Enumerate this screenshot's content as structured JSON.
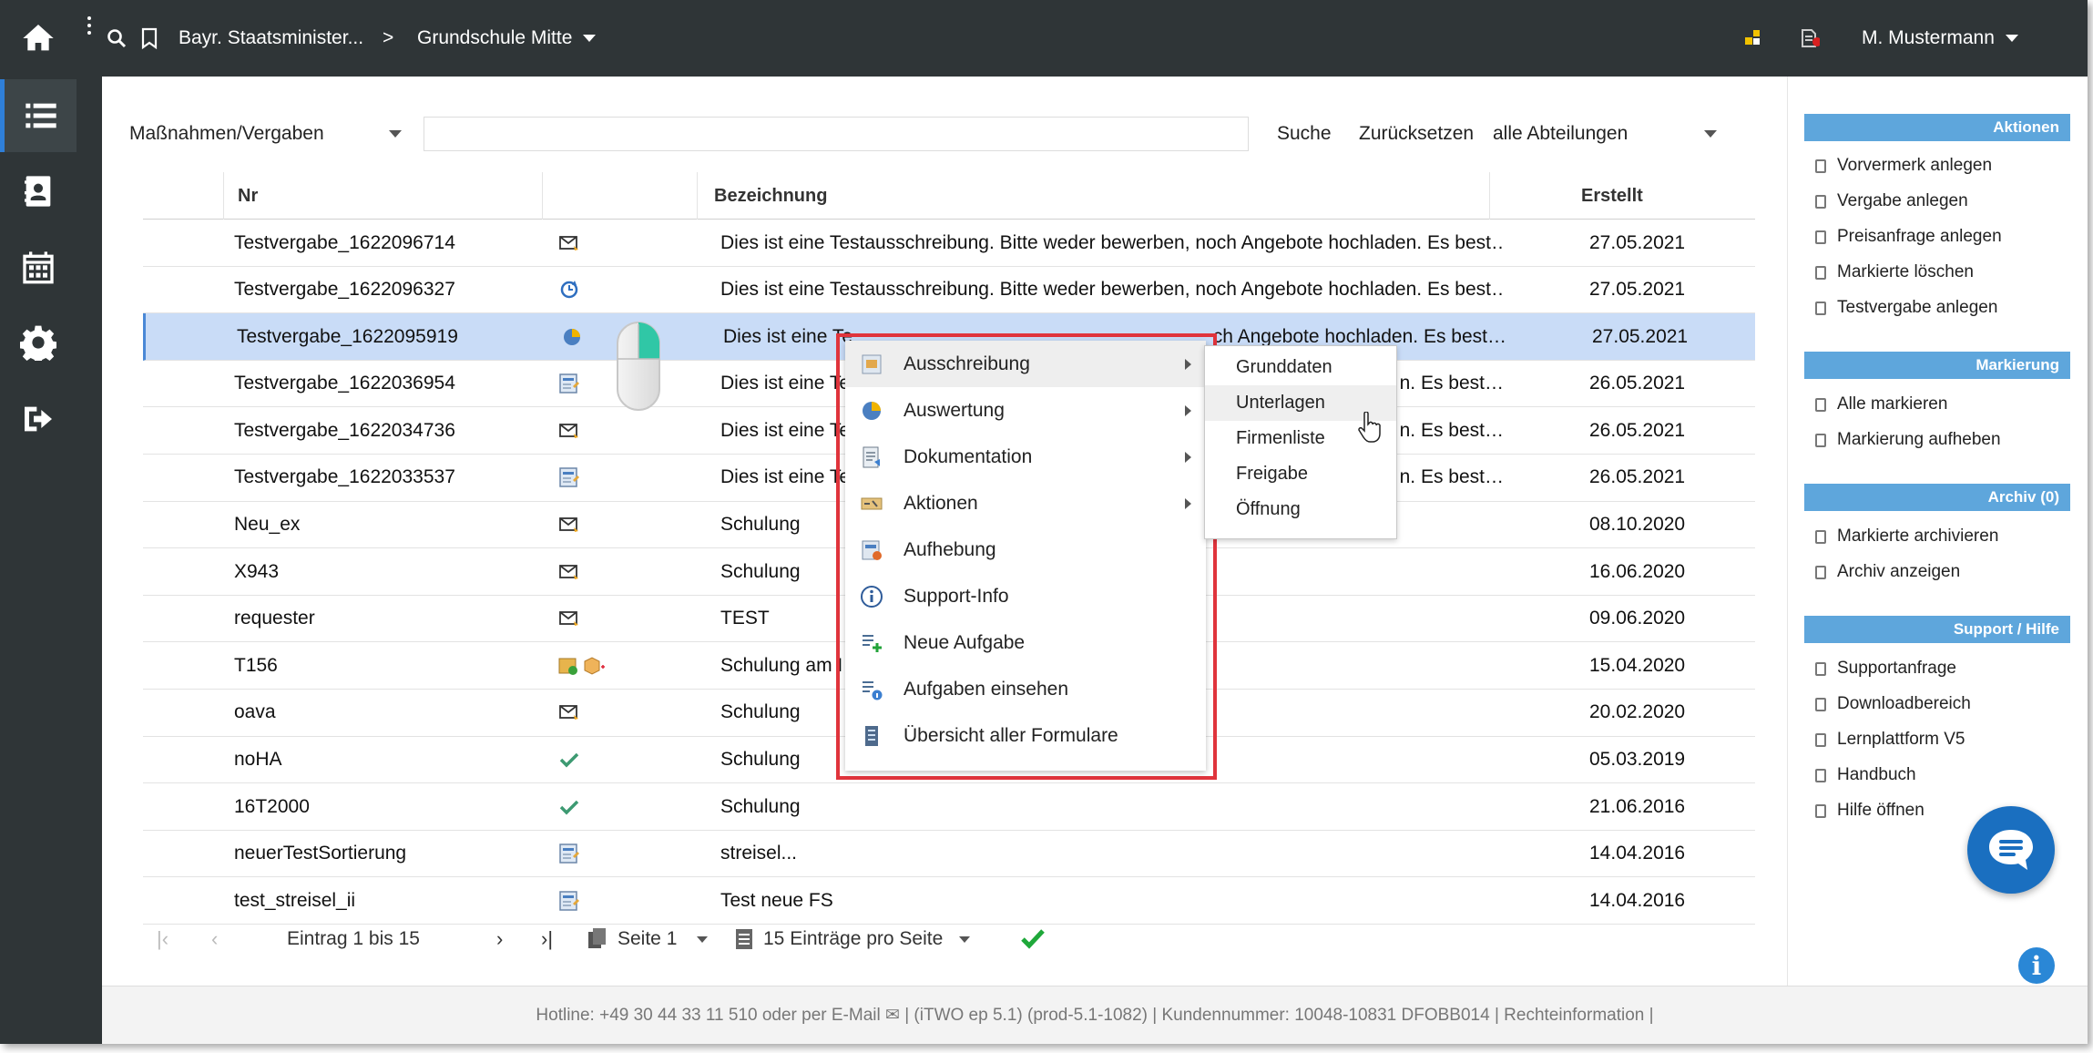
{
  "topbar": {
    "breadcrumb_org": "Bayr. Staatsminister...",
    "breadcrumb_separator": ">",
    "breadcrumb_school": "Grundschule Mitte",
    "user_name": "M. Mustermann"
  },
  "filter": {
    "selected": "Maßnahmen/Vergaben",
    "search_value": "",
    "search_label": "Suche",
    "reset_label": "Zurücksetzen",
    "department": "alle Abteilungen"
  },
  "table": {
    "headers": {
      "nr": "Nr",
      "bez": "Bezeichnung",
      "date": "Erstellt"
    },
    "rows": [
      {
        "nr": "Testvergabe_1622096714",
        "icon": "envelope-icon",
        "bez": "Dies ist eine Testausschreibung. Bitte weder bewerben, noch Angebote hochladen. Es best…",
        "date": "27.05.2021"
      },
      {
        "nr": "Testvergabe_1622096327",
        "icon": "refresh-icon",
        "bez": "Dies ist eine Testausschreibung. Bitte weder bewerben, noch Angebote hochladen. Es best…",
        "date": "27.05.2021"
      },
      {
        "nr": "Testvergabe_1622095919",
        "icon": "pie-icon",
        "bez": "Dies ist eine Te",
        "bez_tail": "ch Angebote hochladen. Es best…",
        "date": "27.05.2021"
      },
      {
        "nr": "Testvergabe_1622036954",
        "icon": "form-icon",
        "bez": "Dies ist eine Te",
        "bez_tail": "n. Es best…",
        "date": "26.05.2021"
      },
      {
        "nr": "Testvergabe_1622034736",
        "icon": "envelope-icon",
        "bez": "Dies ist eine Te",
        "bez_tail": "n. Es best…",
        "date": "26.05.2021"
      },
      {
        "nr": "Testvergabe_1622033537",
        "icon": "form-icon",
        "bez": "Dies ist eine Te",
        "bez_tail": "n. Es best…",
        "date": "26.05.2021"
      },
      {
        "nr": "Neu_ex",
        "icon": "envelope-icon",
        "bez": "Schulung",
        "date": "08.10.2020"
      },
      {
        "nr": "X943",
        "icon": "envelope-icon",
        "bez": "Schulung",
        "date": "16.06.2020"
      },
      {
        "nr": "requester",
        "icon": "envelope-icon",
        "bez": "TEST",
        "date": "09.06.2020"
      },
      {
        "nr": "T156",
        "icon": "package-icon",
        "bez": "Schulung am I",
        "date": "15.04.2020"
      },
      {
        "nr": "oava",
        "icon": "envelope-icon",
        "bez": "Schulung",
        "date": "20.02.2020"
      },
      {
        "nr": "noHA",
        "icon": "check-icon",
        "bez": "Schulung",
        "date": "05.03.2019"
      },
      {
        "nr": "16T2000",
        "icon": "check-icon",
        "bez": "Schulung",
        "date": "21.06.2016"
      },
      {
        "nr": "neuerTestSortierung",
        "icon": "form-icon",
        "bez": "streisel...",
        "date": "14.04.2016"
      },
      {
        "nr": "test_streisel_ii",
        "icon": "form-icon",
        "bez": "Test neue FS",
        "date": "14.04.2016"
      }
    ]
  },
  "pager": {
    "entries": "Eintrag 1 bis 15",
    "page": "Seite 1",
    "per_page": "15 Einträge pro Seite"
  },
  "footer": {
    "text": "Hotline: +49 30 44 33 11 510 oder per E-Mail ✉  |  (iTWO ep 5.1) (prod-5.1-1082)  |  Kundennummer: 10048-10831 DFOBB014 | Rechteinformation  |"
  },
  "right_panel": {
    "aktionen_title": "Aktionen",
    "aktionen": [
      "Vorvermerk anlegen",
      "Vergabe anlegen",
      "Preisanfrage anlegen",
      "Markierte löschen",
      "Testvergabe anlegen"
    ],
    "markierung_title": "Markierung",
    "markierung": [
      "Alle markieren",
      "Markierung aufheben"
    ],
    "archiv_title": "Archiv (0)",
    "archiv": [
      "Markierte archivieren",
      "Archiv anzeigen"
    ],
    "support_title": "Support / Hilfe",
    "support": [
      "Supportanfrage",
      "Downloadbereich",
      "Lernplattform V5",
      "Handbuch",
      "Hilfe öffnen"
    ]
  },
  "context_menu": {
    "items": [
      "Ausschreibung",
      "Auswertung",
      "Dokumentation",
      "Aktionen",
      "Aufhebung",
      "Support-Info",
      "Neue Aufgabe",
      "Aufgaben einsehen",
      "Übersicht aller Formulare"
    ],
    "submenu": [
      "Grunddaten",
      "Unterlagen",
      "Firmenliste",
      "Freigabe",
      "Öffnung"
    ]
  },
  "colors": {
    "sidebar": "#2f3537",
    "accent": "#5ea6dc",
    "selection": "#c9dcf7",
    "highlight_frame": "#e0343c"
  }
}
